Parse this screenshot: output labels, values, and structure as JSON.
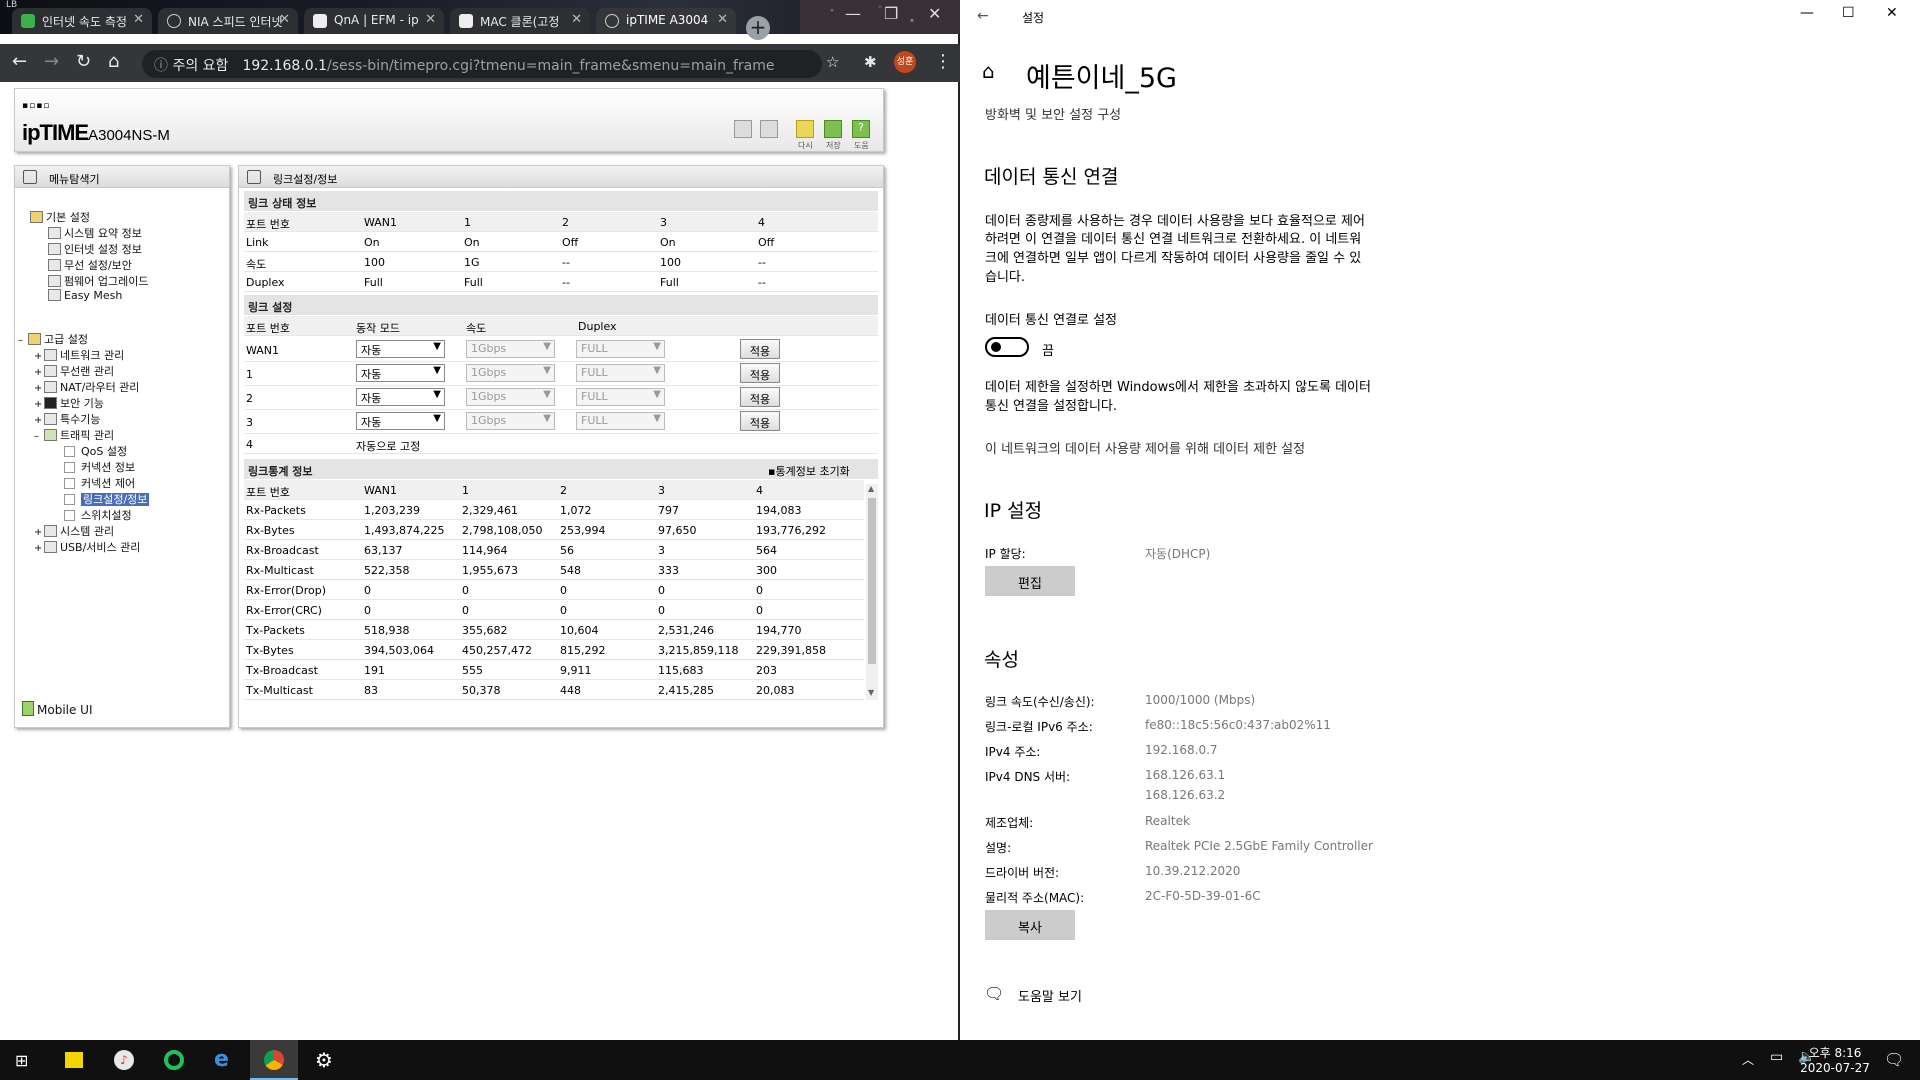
{
  "browser": {
    "tabs": [
      {
        "label": "인터넷 속도 측정"
      },
      {
        "label": "NIA 스피드 인터넷"
      },
      {
        "label": "QnA | EFM - ip"
      },
      {
        "label": "MAC 클론(고정"
      },
      {
        "label": "ipTIME A3004"
      }
    ],
    "url_warning": "주의 요함",
    "url_host": "192.168.0.1",
    "url_path": "/sess-bin/timepro.cgi?tmenu=main_frame&smenu=main_frame",
    "profile": "성훈"
  },
  "iptime": {
    "logo": "ipTIME",
    "model": "A3004NS-M",
    "header_labels": {
      "reboot": "다시",
      "save": "저장",
      "help": "도움"
    },
    "menu": {
      "title": "메뉴탐색기",
      "basic": {
        "label": "기본 설정",
        "items": [
          "시스템 요약 정보",
          "인터넷 설정 정보",
          "무선 설정/보안",
          "펌웨어 업그레이드",
          "Easy Mesh"
        ]
      },
      "advanced": {
        "label": "고급 설정",
        "items": [
          "네트워크 관리",
          "무선랜 관리",
          "NAT/라우터 관리",
          "보안 기능",
          "특수기능",
          "트래픽 관리"
        ],
        "traffic_items": [
          "QoS 설정",
          "커넥션 정보",
          "커넥션 제어",
          "링크설정/정보",
          "스위치설정"
        ],
        "more_items": [
          "시스템 관리",
          "USB/서비스 관리"
        ]
      },
      "mobile": "Mobile UI"
    },
    "main": {
      "title": "링크설정/정보",
      "status": {
        "title": "링크 상태 정보",
        "header": [
          "포트 번호",
          "WAN1",
          "1",
          "2",
          "3",
          "4"
        ],
        "rows": [
          [
            "Link",
            "On",
            "On",
            "Off",
            "On",
            "Off"
          ],
          [
            "속도",
            "100",
            "1G",
            "--",
            "100",
            "--"
          ],
          [
            "Duplex",
            "Full",
            "Full",
            "--",
            "Full",
            "--"
          ]
        ]
      },
      "config": {
        "title": "링크 설정",
        "header": [
          "포트 번호",
          "동작 모드",
          "속도",
          "Duplex"
        ],
        "ports": [
          "WAN1",
          "1",
          "2",
          "3"
        ],
        "mode": "자동",
        "speed": "1Gbps",
        "duplex": "FULL",
        "apply": "적용",
        "fixed_port": "4",
        "fixed_text": "자동으로 고정"
      },
      "stats": {
        "title": "링크통계 정보",
        "reset": "통계정보 초기화",
        "header": [
          "포트 번호",
          "WAN1",
          "1",
          "2",
          "3",
          "4"
        ],
        "rows": [
          [
            "Rx-Packets",
            "1,203,239",
            "2,329,461",
            "1,072",
            "797",
            "194,083"
          ],
          [
            "Rx-Bytes",
            "1,493,874,225",
            "2,798,108,050",
            "253,994",
            "97,650",
            "193,776,292"
          ],
          [
            "Rx-Broadcast",
            "63,137",
            "114,964",
            "56",
            "3",
            "564"
          ],
          [
            "Rx-Multicast",
            "522,358",
            "1,955,673",
            "548",
            "333",
            "300"
          ],
          [
            "Rx-Error(Drop)",
            "0",
            "0",
            "0",
            "0",
            "0"
          ],
          [
            "Rx-Error(CRC)",
            "0",
            "0",
            "0",
            "0",
            "0"
          ],
          [
            "Tx-Packets",
            "518,938",
            "355,682",
            "10,604",
            "2,531,246",
            "194,770"
          ],
          [
            "Tx-Bytes",
            "394,503,064",
            "450,257,472",
            "815,292",
            "3,215,859,118",
            "229,391,858"
          ],
          [
            "Tx-Broadcast",
            "191",
            "555",
            "9,911",
            "115,683",
            "203"
          ],
          [
            "Tx-Multicast",
            "83",
            "50,378",
            "448",
            "2,415,285",
            "20,083"
          ]
        ]
      }
    }
  },
  "settings": {
    "window_title": "설정",
    "page_title": "예튼이네_5G",
    "firewall_link": "방화벽 및 보안 설정 구성",
    "metered": {
      "heading": "데이터 통신 연결",
      "desc": [
        "데이터 종량제를 사용하는 경우 데이터 사용량을 보다 효율적으로 제어",
        "하려면 이 연결을 데이터 통신 연결 네트워크로 전환하세요. 이 네트워",
        "크에 연결하면 일부 앱이 다르게 작동하여 데이터 사용량을 줄일 수 있",
        "습니다."
      ],
      "toggle_label": "데이터 통신 연결로 설정",
      "toggle_state": "끔",
      "desc2": [
        "데이터 제한을 설정하면 Windows에서 제한을 초과하지 않도록 데이터",
        "통신 연결을 설정합니다."
      ],
      "limit_link": "이 네트워크의 데이터 사용량 제어를 위해 데이터 제한 설정"
    },
    "ip": {
      "heading": "IP 설정",
      "assign_label": "IP 할당:",
      "assign_value": "자동(DHCP)",
      "edit": "편집"
    },
    "props": {
      "heading": "속성",
      "rows": [
        [
          "링크 속도(수신/송신):",
          "1000/1000 (Mbps)"
        ],
        [
          "링크-로컬 IPv6 주소:",
          "fe80::18c5:56c0:437:ab02%11"
        ],
        [
          "IPv4 주소:",
          "192.168.0.7"
        ],
        [
          "IPv4 DNS 서버:",
          "168.126.63.1"
        ],
        [
          "",
          "168.126.63.2"
        ],
        [
          "제조업체:",
          "Realtek"
        ],
        [
          "설명:",
          "Realtek PCIe 2.5GbE Family Controller"
        ],
        [
          "드라이버 버전:",
          "10.39.212.2020"
        ],
        [
          "물리적 주소(MAC):",
          "2C-F0-5D-39-01-6C"
        ]
      ],
      "copy": "복사"
    },
    "help": "도움말 보기"
  },
  "taskbar": {
    "time": "오후 8:16",
    "date": "2020-07-27"
  },
  "colors": {
    "chrome_dark": "#35363a",
    "iptime_select": "#4a6db8",
    "taskbar": "#101010"
  }
}
